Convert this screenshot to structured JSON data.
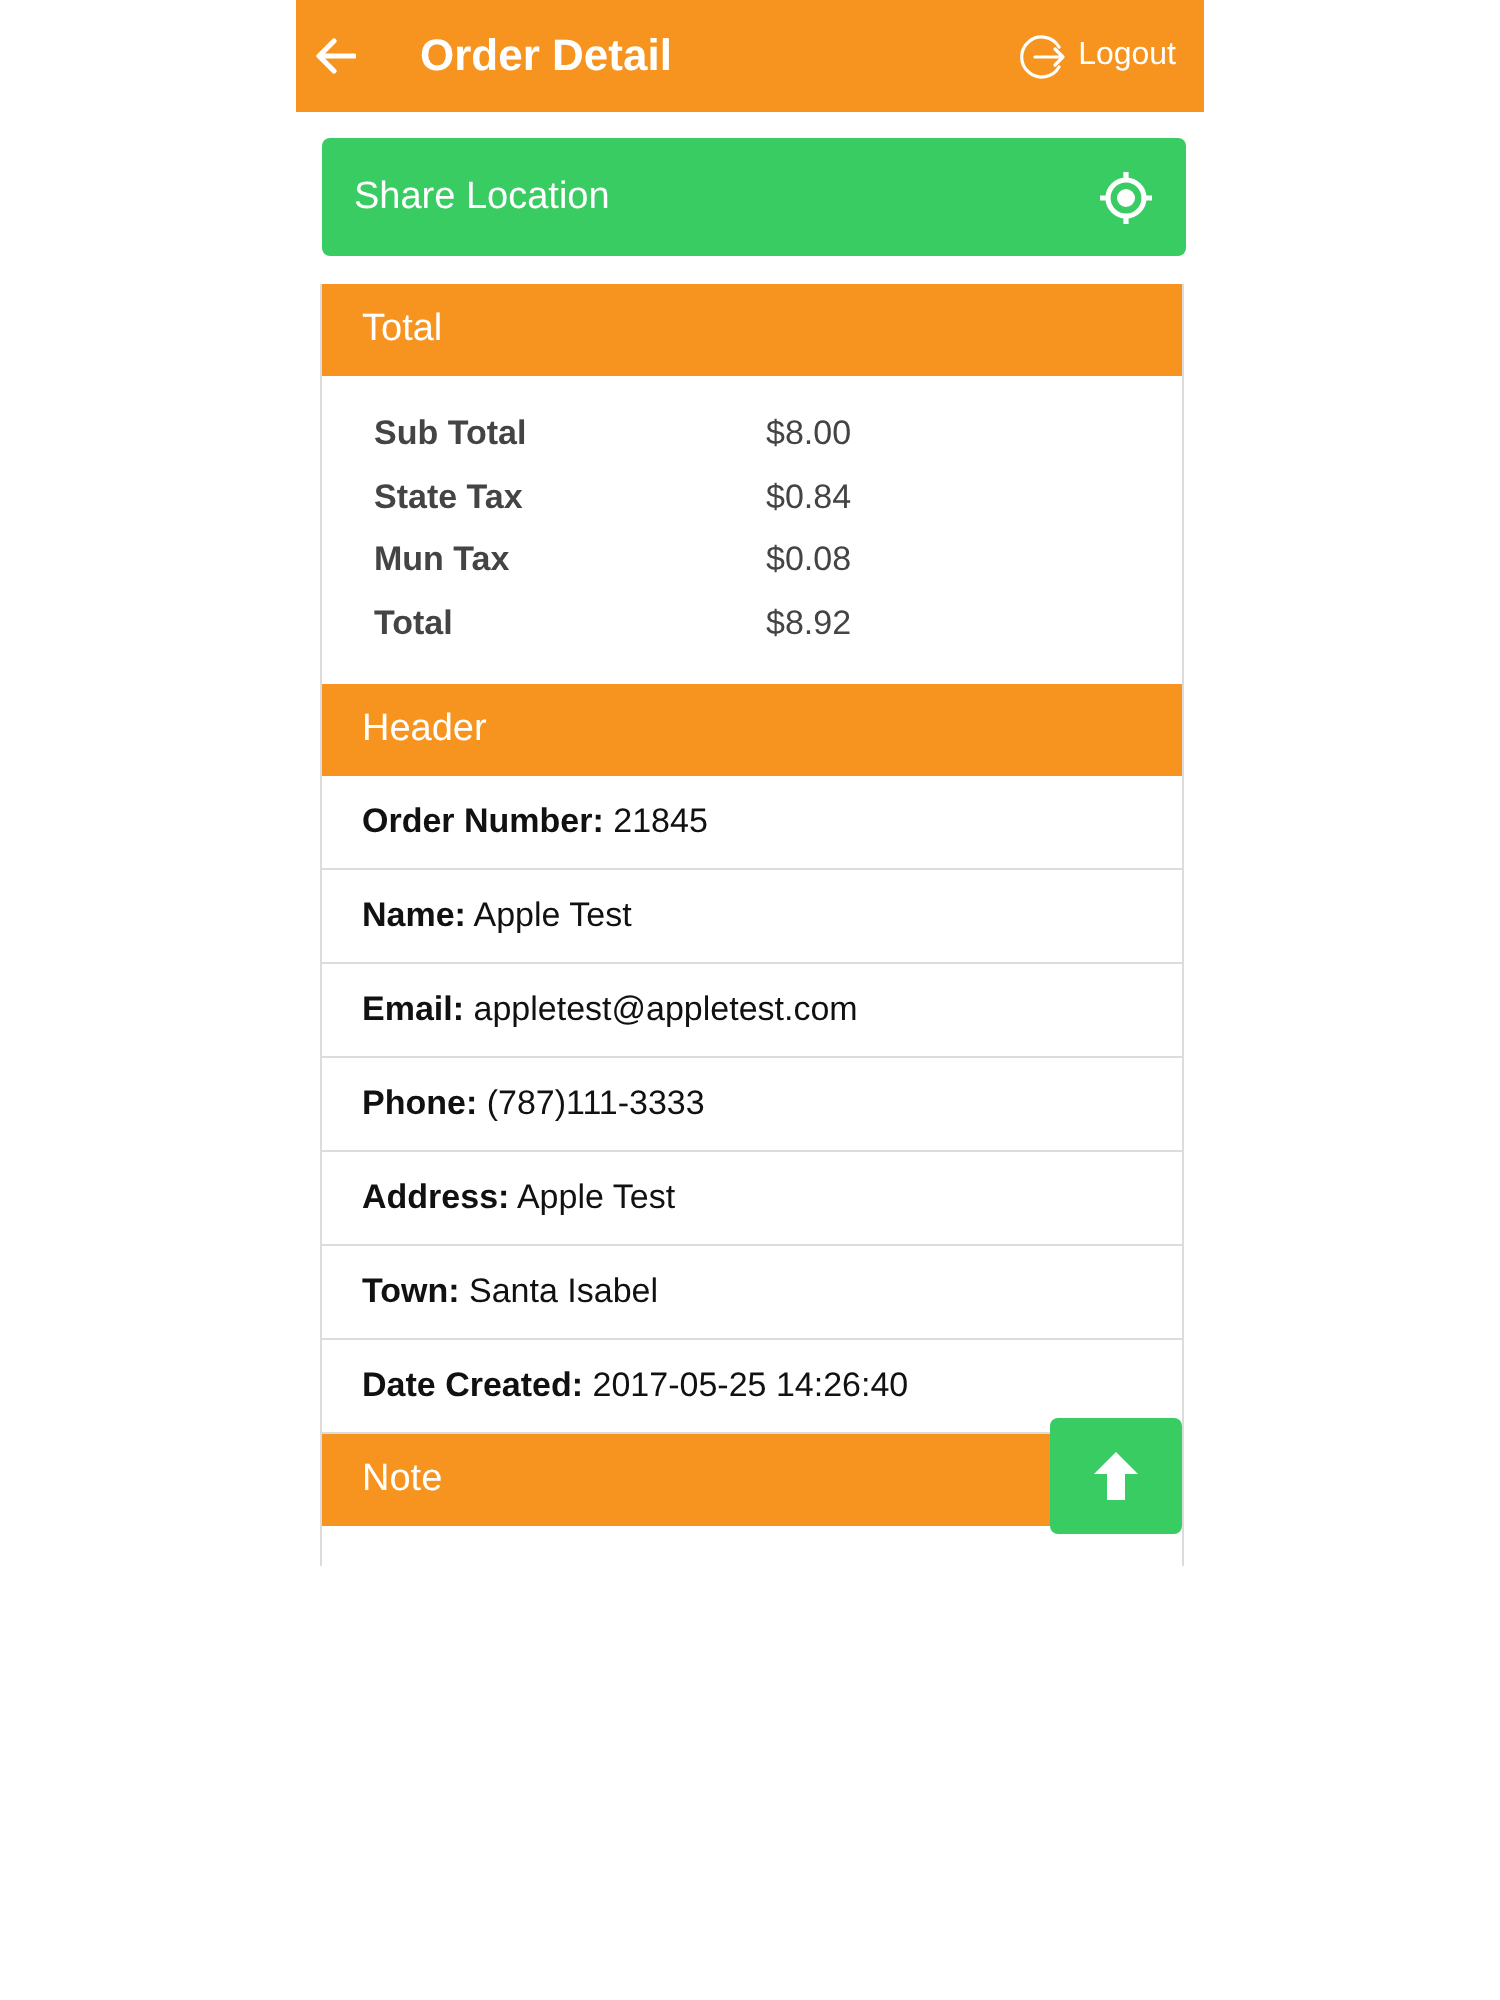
{
  "app_bar": {
    "title": "Order Detail",
    "logout_label": "Logout"
  },
  "share_location": {
    "label": "Share Location"
  },
  "sections": [
    {
      "kind": "totals",
      "title": "Total",
      "rows": [
        {
          "label": "Sub Total",
          "value": "$8.00"
        },
        {
          "label": "State Tax",
          "value": "$0.84"
        },
        {
          "label": "Mun Tax",
          "value": "$0.08"
        },
        {
          "label": "Total",
          "value": "$8.92"
        }
      ]
    },
    {
      "kind": "fields",
      "title": "Header",
      "rows": [
        {
          "text": "**Order Number:** 21845"
        },
        {
          "text": "**Name:** Apple Test"
        },
        {
          "text": "**Email:** appletest@appletest.com"
        },
        {
          "text": "**Phone:** (787)111-3333"
        },
        {
          "text": "**Address:** Apple Test"
        },
        {
          "text": "**Town:** Santa Isabel"
        },
        {
          "text": "**Date Created:** 2017-05-25 14:26:40"
        }
      ]
    },
    {
      "kind": "note",
      "title": "Note"
    }
  ]
}
